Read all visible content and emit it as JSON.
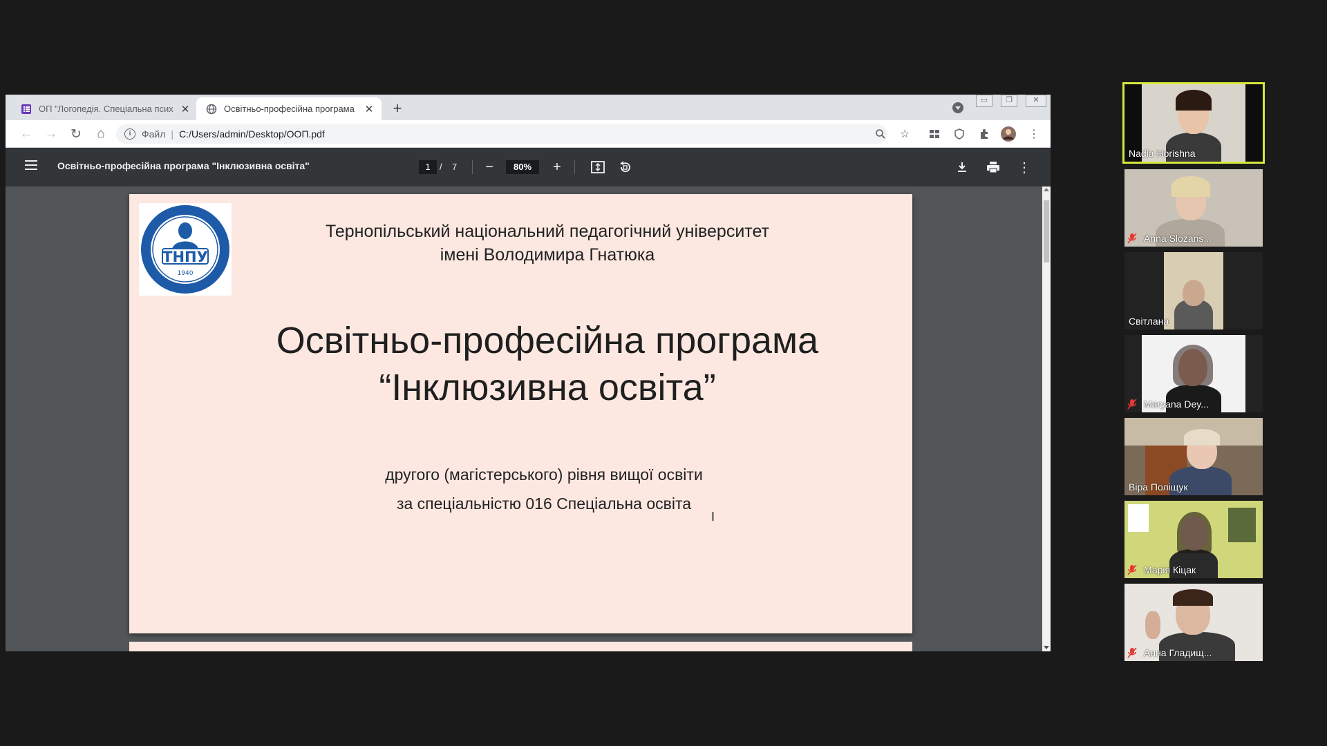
{
  "browser": {
    "tabs": [
      {
        "title": "ОП \"Логопедія. Спеціальна псих",
        "active": false,
        "favicon": "forms-icon"
      },
      {
        "title": "Освітньо-професійна програма",
        "active": true,
        "favicon": "globe-icon"
      }
    ],
    "omnibox": {
      "scheme": "Файл",
      "url": "C:/Users/admin/Desktop/ООП.pdf"
    }
  },
  "pdf": {
    "title": "Освітньо-професійна програма \"Інклюзивна освіта\"",
    "page_current": "1",
    "page_separator": "/",
    "page_total": "7",
    "zoom": "80%",
    "content": {
      "logo_text": "ТНПУ",
      "logo_year": "1940",
      "university_line1": "Тернопільський національний педагогічний університет",
      "university_line2": "імені Володимира Гнатюка",
      "title_line1": "Освітньо-професійна програма",
      "title_line2": "“Інклюзивна освіта”",
      "subtitle_line1": "другого (магістерського) рівня вищої освіти",
      "subtitle_line2": "за спеціальністю 016 Спеціальна освіта"
    }
  },
  "participants": [
    {
      "name": "Nadia Horishna",
      "muted": false,
      "speaking": true
    },
    {
      "name": "Anna Slozans...",
      "muted": true,
      "speaking": false
    },
    {
      "name": "Світлана",
      "muted": false,
      "speaking": false
    },
    {
      "name": "Maryana Dey...",
      "muted": true,
      "speaking": false
    },
    {
      "name": "Віра Поліщук",
      "muted": false,
      "speaking": false
    },
    {
      "name": "Марія Кіцак",
      "muted": true,
      "speaking": false
    },
    {
      "name": "Анна Гладищ...",
      "muted": true,
      "speaking": false
    }
  ],
  "colors": {
    "speaking_border": "#d5e83c",
    "pdf_page": "#fce8e1",
    "pdf_toolbar": "#323639",
    "logo_blue": "#1d5ba8"
  }
}
